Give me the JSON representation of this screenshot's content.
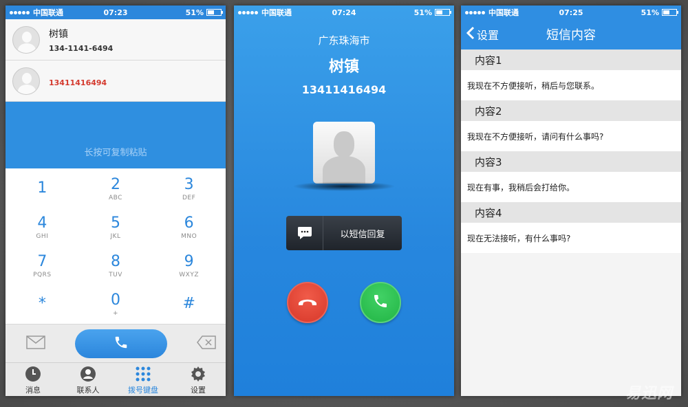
{
  "status": {
    "carrier": "中国联通",
    "battery": "51%",
    "battery_level": 0.51
  },
  "screen1": {
    "time": "07:23",
    "contacts": [
      {
        "name": "树镇",
        "number": "134-1141-6494",
        "number_color": "#333333"
      },
      {
        "name": "",
        "number": "13411416494",
        "number_color": "#d43a2e"
      }
    ],
    "paste_hint": "长按可复制粘贴",
    "keys": [
      {
        "digit": "1",
        "letters": ""
      },
      {
        "digit": "2",
        "letters": "ABC"
      },
      {
        "digit": "3",
        "letters": "DEF"
      },
      {
        "digit": "4",
        "letters": "GHI"
      },
      {
        "digit": "5",
        "letters": "JKL"
      },
      {
        "digit": "6",
        "letters": "MNO"
      },
      {
        "digit": "7",
        "letters": "PQRS"
      },
      {
        "digit": "8",
        "letters": "TUV"
      },
      {
        "digit": "9",
        "letters": "WXYZ"
      },
      {
        "digit": "*",
        "letters": ""
      },
      {
        "digit": "0",
        "letters": "+"
      },
      {
        "digit": "#",
        "letters": ""
      }
    ],
    "tabs": [
      {
        "label": "消息",
        "icon": "clock-icon"
      },
      {
        "label": "联系人",
        "icon": "contact-icon"
      },
      {
        "label": "拨号键盘",
        "icon": "keypad-icon",
        "active": true
      },
      {
        "label": "设置",
        "icon": "gear-icon"
      }
    ],
    "accent": "#2c87dc"
  },
  "screen2": {
    "time": "07:24",
    "location": "广东珠海市",
    "caller_name": "树镇",
    "caller_number": "13411416494",
    "reply_label": "以短信回复",
    "decline_color": "#d7382a",
    "accept_color": "#22b545"
  },
  "screen3": {
    "time": "07:25",
    "back_label": "设置",
    "title": "短信内容",
    "sections": [
      {
        "header": "内容1",
        "text": "我现在不方便接听，稍后与您联系。"
      },
      {
        "header": "内容2",
        "text": "我现在不方便接听，请问有什么事吗?"
      },
      {
        "header": "内容3",
        "text": "现在有事，我稍后会打给你。"
      },
      {
        "header": "内容4",
        "text": "现在无法接听，有什么事吗?"
      }
    ]
  },
  "watermark": "易迅网"
}
